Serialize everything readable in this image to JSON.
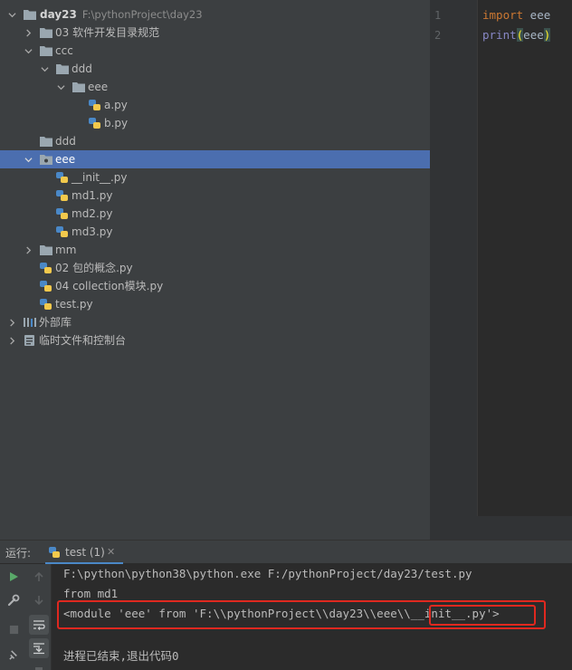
{
  "project_tree": {
    "root": {
      "name": "day23",
      "path": "F:\\pythonProject\\day23"
    },
    "items": [
      {
        "label": "03 软件开发目录规范"
      },
      {
        "label": "ccc"
      },
      {
        "label": "ddd"
      },
      {
        "label": "eee"
      },
      {
        "label": "a.py"
      },
      {
        "label": "b.py"
      },
      {
        "label": "ddd"
      },
      {
        "label": "eee"
      },
      {
        "label": "__init__.py"
      },
      {
        "label": "md1.py"
      },
      {
        "label": "md2.py"
      },
      {
        "label": "md3.py"
      },
      {
        "label": "mm"
      },
      {
        "label": "02 包的概念.py"
      },
      {
        "label": "04 collection模块.py"
      },
      {
        "label": "test.py"
      },
      {
        "label": "外部库"
      },
      {
        "label": "临时文件和控制台"
      }
    ]
  },
  "editor": {
    "lines": [
      {
        "num": "1",
        "keyword": "import",
        "rest": " eee"
      },
      {
        "num": "2",
        "func": "print",
        "open": "(",
        "arg": "eee",
        "close": ")"
      }
    ]
  },
  "run_panel": {
    "title": "运行:",
    "tab_label": "test (1)",
    "tab_close": "✕",
    "output": [
      "F:\\python\\python38\\python.exe F:/pythonProject/day23/test.py",
      "from md1",
      "<module 'eee' from 'F:\\\\pythonProject\\\\day23\\\\eee\\\\__init__.py'>",
      "",
      "进程已结束,退出代码0"
    ]
  },
  "colors": {
    "selection": "#4b6eaf",
    "highlight_box": "#e0281f",
    "keyword": "#cc7832",
    "builtin": "#8888c6"
  }
}
